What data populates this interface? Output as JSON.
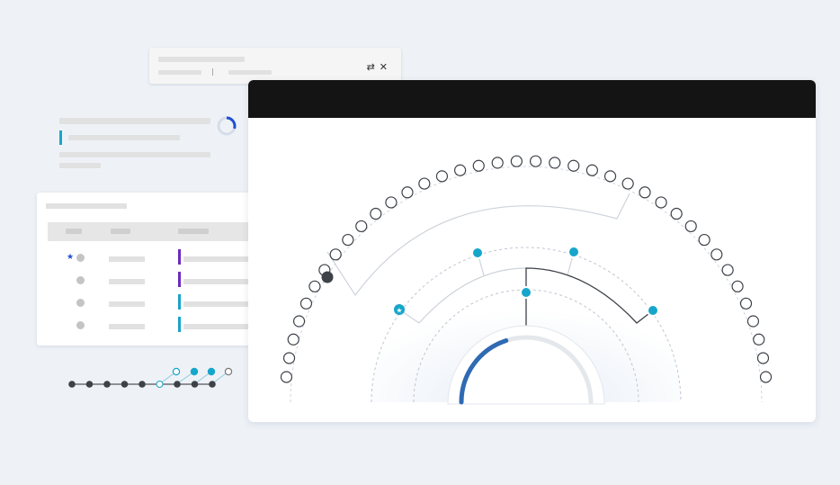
{
  "top_panel": {
    "icons": [
      "swap-icon",
      "close-icon"
    ],
    "swap_glyph": "⇄",
    "close_glyph": "✕"
  },
  "text_block": {
    "progress_ring": {
      "fraction": 0.3,
      "color": "#1f4fd1"
    }
  },
  "table": {
    "rows": [
      {
        "starred": true,
        "indicator_color": "#6a2cc0"
      },
      {
        "starred": false,
        "indicator_color": "#6a2cc0"
      },
      {
        "starred": false,
        "indicator_color": "#1aa3c9"
      },
      {
        "starred": false,
        "indicator_color": "#1aa3c9"
      }
    ],
    "star_glyph": "★"
  },
  "radial_view": {
    "outer_ring_node_count": 38,
    "selected_outer_node_color": "#3d4148",
    "inner_node_color": "#16a6c9",
    "gauge": {
      "fraction": 0.4,
      "color": "#2f6ab3"
    }
  },
  "sparkline": {
    "points": [
      "dark",
      "dark",
      "dark",
      "dark",
      "dark",
      "open",
      "dark",
      "dark",
      "dark",
      "open"
    ],
    "teal_points": [
      "teal-open",
      "teal",
      "teal",
      "open"
    ]
  },
  "colors": {
    "accent_blue": "#1f4fd1",
    "teal": "#16a6c9",
    "purple": "#6a2cc0",
    "dark": "#141414"
  }
}
